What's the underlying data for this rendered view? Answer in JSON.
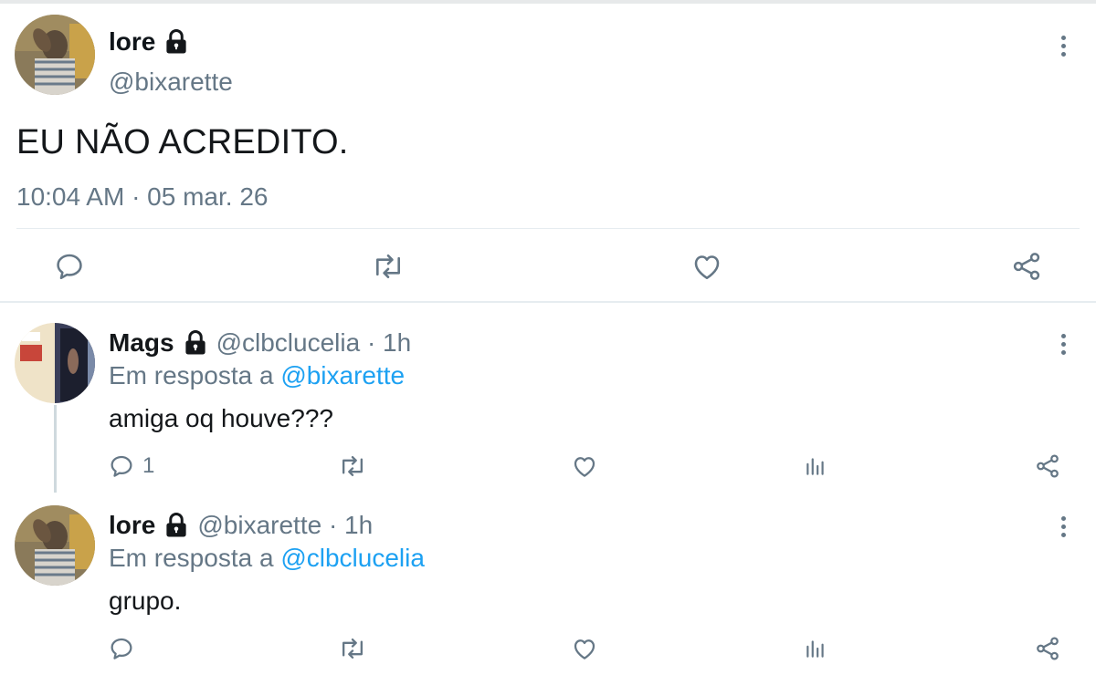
{
  "main_tweet": {
    "name": "lore",
    "handle": "@bixarette",
    "text": "EU NÃO ACREDITO.",
    "timestamp": "10:04 AM · 05 mar. 26",
    "icons": [
      "lock-icon",
      "more-icon",
      "reply-icon",
      "retweet-icon",
      "like-icon",
      "share-icon"
    ]
  },
  "replies": [
    {
      "name": "Mags",
      "meta": "@clbclucelia · 1h",
      "in_reply_prefix": "Em resposta a ",
      "in_reply_mention": "@bixarette",
      "text": "amiga oq houve???",
      "reply_count": "1"
    },
    {
      "name": "lore",
      "meta": "@bixarette · 1h",
      "in_reply_prefix": "Em resposta a ",
      "in_reply_mention": "@clbclucelia",
      "text": "grupo.",
      "reply_count": ""
    }
  ],
  "colors": {
    "text": "#14171a",
    "secondary": "#657786",
    "link": "#1da1f2",
    "divider": "#e6ecf0"
  }
}
